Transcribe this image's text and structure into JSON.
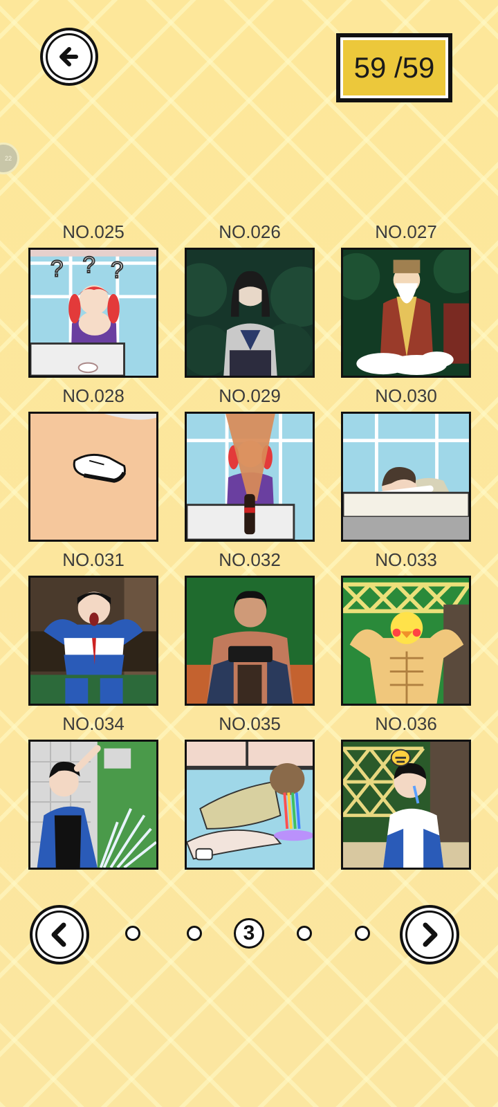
{
  "header": {
    "counter_text": "59 /59",
    "side_badge": "22"
  },
  "gallery": {
    "items": [
      {
        "label": "NO.025",
        "scene": "girl-confused-icon"
      },
      {
        "label": "NO.026",
        "scene": "schoolgirl-forest-icon"
      },
      {
        "label": "NO.027",
        "scene": "old-sage-cloud-icon"
      },
      {
        "label": "NO.028",
        "scene": "shoe-on-floor-icon"
      },
      {
        "label": "NO.029",
        "scene": "cola-fountain-icon"
      },
      {
        "label": "NO.030",
        "scene": "boy-sleeping-desk-icon"
      },
      {
        "label": "NO.031",
        "scene": "student-screaming-icon"
      },
      {
        "label": "NO.032",
        "scene": "boy-gaming-icon"
      },
      {
        "label": "NO.033",
        "scene": "muscle-duck-icon"
      },
      {
        "label": "NO.034",
        "scene": "boy-water-splash-icon"
      },
      {
        "label": "NO.035",
        "scene": "girl-rainbow-icon"
      },
      {
        "label": "NO.036",
        "scene": "boy-bee-crying-icon"
      }
    ]
  },
  "pager": {
    "current_page": "3",
    "total_dots": 5
  },
  "colors": {
    "background": "#fde89a",
    "counter_fill": "#ecc83b",
    "outline": "#111111"
  }
}
